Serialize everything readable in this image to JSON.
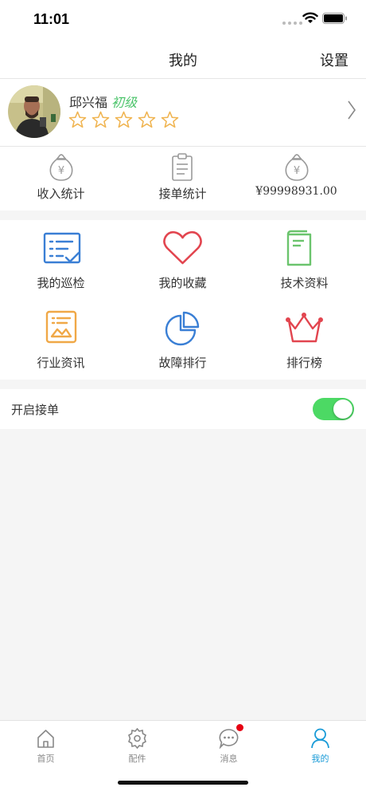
{
  "status_bar": {
    "time": "11:01"
  },
  "nav": {
    "title": "我的",
    "settings_label": "设置"
  },
  "profile": {
    "name": "邱兴福",
    "level": "初级",
    "rating": 0,
    "rating_max": 5
  },
  "stats": [
    {
      "label": "收入统计",
      "icon": "money-bag-icon"
    },
    {
      "label": "接单统计",
      "icon": "clipboard-icon"
    },
    {
      "label": "¥99998931.00",
      "icon": "money-bag-icon"
    }
  ],
  "features": [
    {
      "label": "我的巡检",
      "icon": "inspection-list-icon"
    },
    {
      "label": "我的收藏",
      "icon": "heart-icon"
    },
    {
      "label": "技术资料",
      "icon": "book-icon"
    },
    {
      "label": "行业资讯",
      "icon": "news-chart-icon"
    },
    {
      "label": "故障排行",
      "icon": "pie-chart-icon"
    },
    {
      "label": "排行榜",
      "icon": "crown-icon"
    }
  ],
  "order_toggle": {
    "label": "开启接单",
    "on": true
  },
  "tabs": [
    {
      "label": "首页",
      "icon": "home-icon"
    },
    {
      "label": "配件",
      "icon": "parts-icon"
    },
    {
      "label": "消息",
      "icon": "message-icon"
    },
    {
      "label": "我的",
      "icon": "user-icon"
    }
  ],
  "colors": {
    "accent": "#1a9bd7",
    "toggle_on": "#4cd964",
    "level": "#4cc46b",
    "star": "#f0b450",
    "blue_icon": "#3a7fd5",
    "red_icon": "#e2454f",
    "green_icon": "#6bc46d",
    "orange_icon": "#f0a847"
  }
}
